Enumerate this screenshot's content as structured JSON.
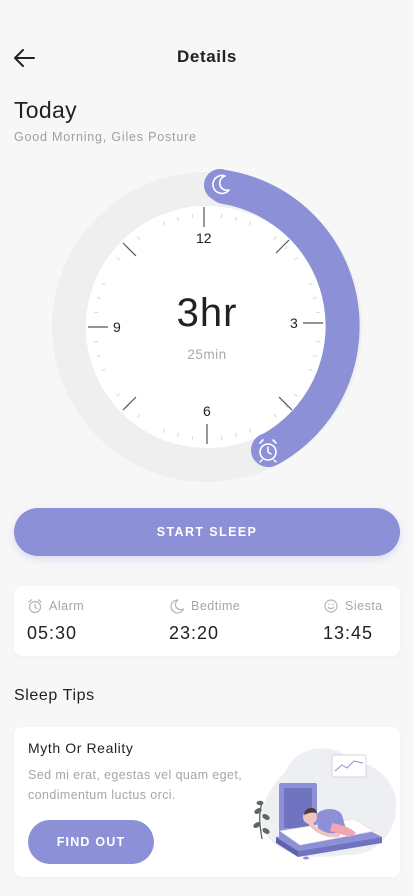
{
  "header": {
    "title": "Details",
    "back_icon": "arrow-left-icon"
  },
  "today": {
    "title": "Today",
    "greeting": "Good Morning, Giles Posture"
  },
  "dial": {
    "hours_label": "3hr",
    "minutes_label": "25min",
    "numbers": {
      "twelve": "12",
      "three": "3",
      "six": "6",
      "nine": "9"
    },
    "start_icon": "moon-icon",
    "end_icon": "alarm-clock-icon",
    "accent": "#8c90d6",
    "track_color": "#eeeeee"
  },
  "start_button": {
    "label": "START SLEEP"
  },
  "stats": {
    "alarm": {
      "label": "Alarm",
      "value": "05:30",
      "icon": "alarm-icon"
    },
    "bedtime": {
      "label": "Bedtime",
      "value": "23:20",
      "icon": "moon-icon"
    },
    "siesta": {
      "label": "Siesta",
      "value": "13:45",
      "icon": "smile-icon"
    }
  },
  "tips": {
    "section_title": "Sleep Tips",
    "card": {
      "heading": "Myth Or Reality",
      "body": "Sed mi erat, egestas vel quam eget, condimentum luctus orci.",
      "button_label": "FIND OUT",
      "illustration": "sleeping-person-illustration"
    }
  }
}
